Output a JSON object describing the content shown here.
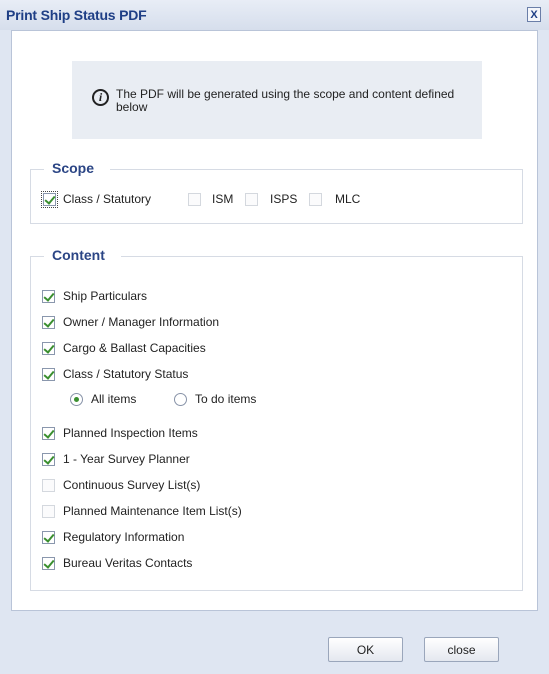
{
  "dialog": {
    "title": "Print Ship Status PDF",
    "close_label": "X"
  },
  "info": {
    "icon": "info-icon",
    "message": "The PDF will be generated using the scope and content defined below"
  },
  "scope": {
    "legend": "Scope",
    "items": [
      {
        "label": "Class / Statutory",
        "checked": true
      },
      {
        "label": "ISM",
        "checked": false
      },
      {
        "label": "ISPS",
        "checked": false
      },
      {
        "label": "MLC",
        "checked": false
      }
    ]
  },
  "content": {
    "legend": "Content",
    "items": [
      {
        "label": "Ship Particulars",
        "checked": true
      },
      {
        "label": "Owner / Manager Information",
        "checked": true
      },
      {
        "label": "Cargo & Ballast Capacities",
        "checked": true
      },
      {
        "label": "Class / Statutory Status",
        "checked": true
      },
      {
        "label": "Planned Inspection Items",
        "checked": true
      },
      {
        "label": "1 - Year Survey Planner",
        "checked": true
      },
      {
        "label": "Continuous Survey List(s)",
        "checked": false
      },
      {
        "label": "Planned Maintenance Item List(s)",
        "checked": false
      },
      {
        "label": "Regulatory Information",
        "checked": true
      },
      {
        "label": "Bureau Veritas Contacts",
        "checked": true
      }
    ],
    "status_options": [
      {
        "label": "All items",
        "selected": true
      },
      {
        "label": "To do items",
        "selected": false
      }
    ]
  },
  "buttons": {
    "ok": "OK",
    "close": "close"
  },
  "colors": {
    "title": "#1f3f86",
    "check": "#3a8f2f",
    "background": "#dfe6f2"
  }
}
